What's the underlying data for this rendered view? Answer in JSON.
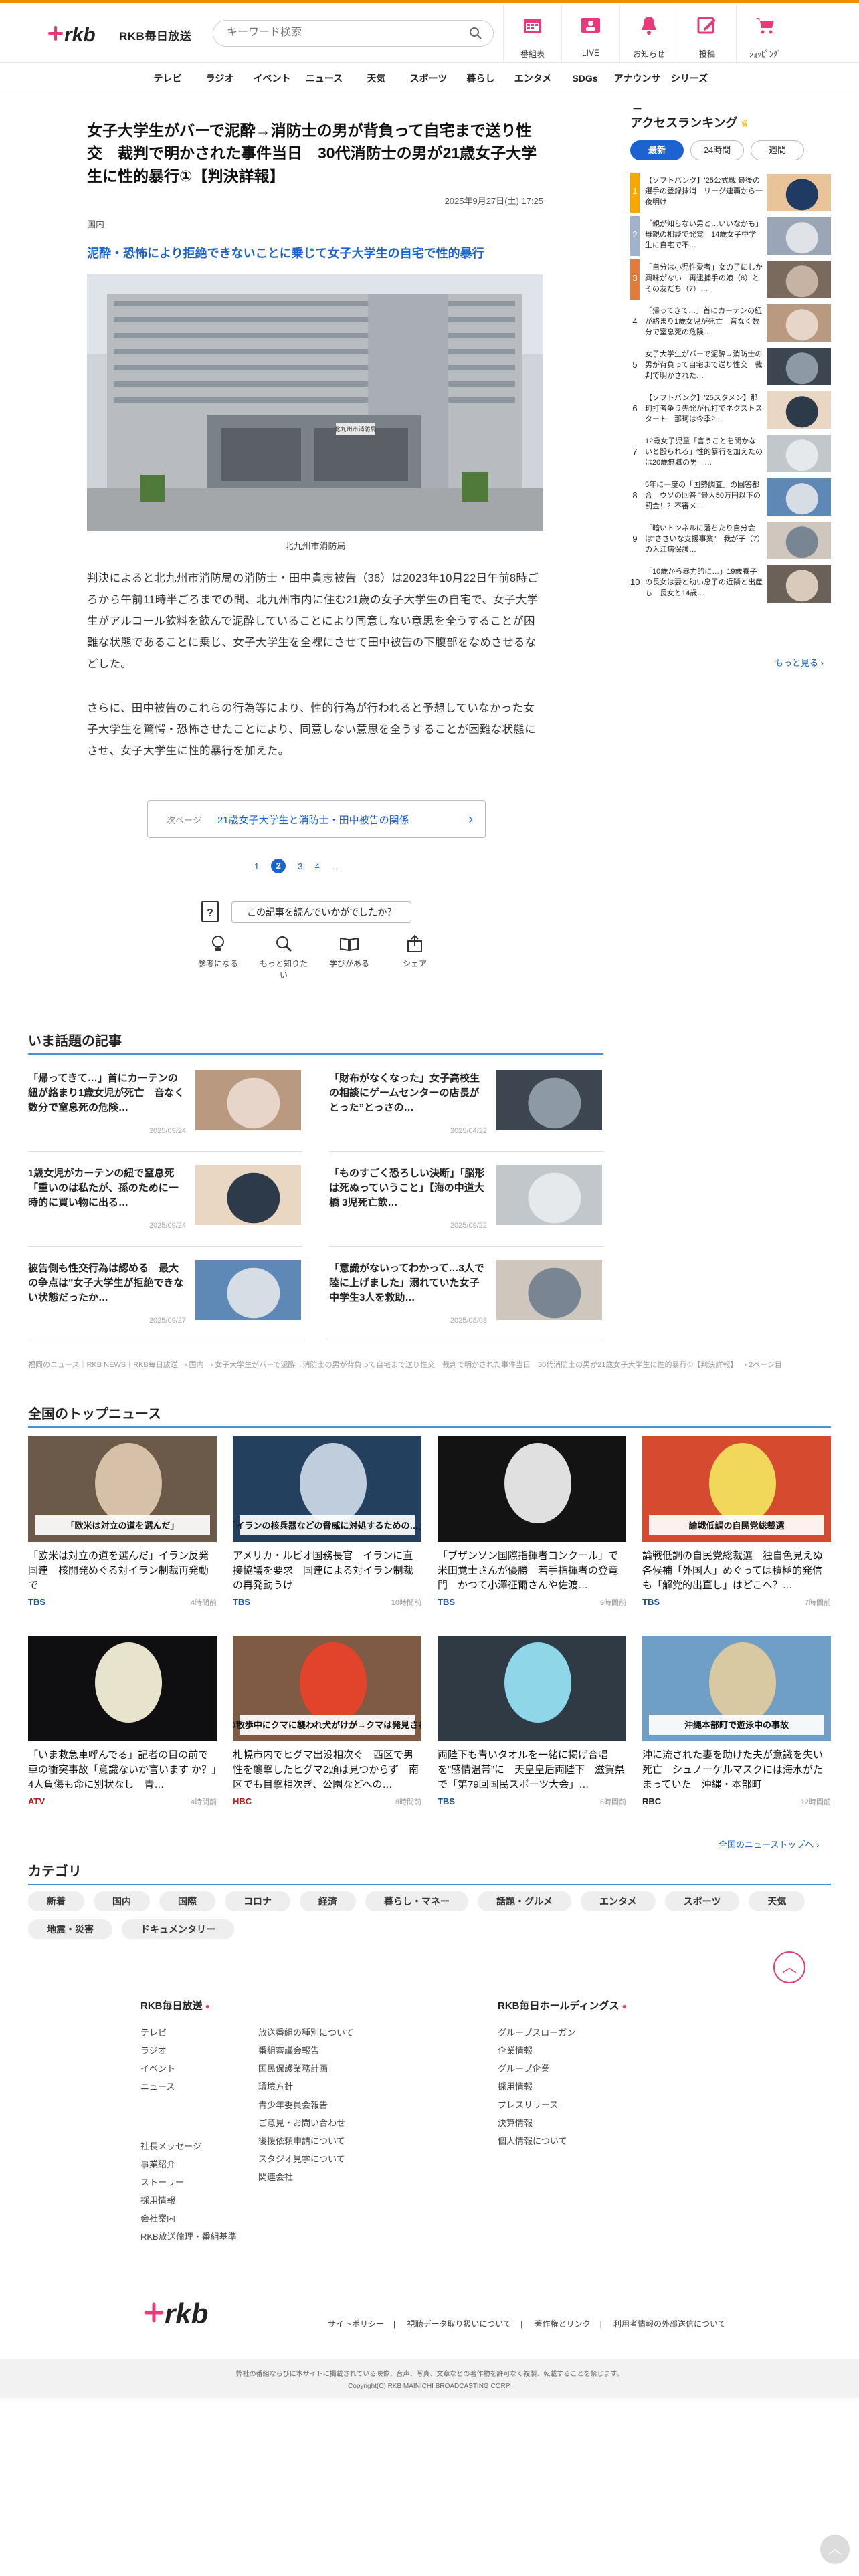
{
  "header": {
    "logo_text": "rkb",
    "brand": "RKB毎日放送",
    "search_placeholder": "キーワード検索",
    "tools": [
      {
        "label": "番組表",
        "icon": "calendar-icon"
      },
      {
        "label": "LIVE",
        "icon": "live-icon"
      },
      {
        "label": "お知らせ",
        "icon": "bell-icon"
      },
      {
        "label": "投稿",
        "icon": "post-icon"
      },
      {
        "label": "ｼｮｯﾋﾟﾝｸﾞ",
        "icon": "cart-icon"
      }
    ]
  },
  "gnav": [
    "テレビ",
    "ラジオ",
    "イベント",
    "ニュース",
    "天気",
    "スポーツ",
    "暮らし",
    "エンタメ",
    "SDGs",
    "アナウンサー",
    "シリーズ"
  ],
  "article": {
    "title": "女子大学生がバーで泥酔→消防士の男が背負って自宅まで送り性交　裁判で明かされた事件当日　30代消防士の男が21歳女子大学生に性的暴行①【判決詳報】",
    "date": "2025年9月27日(土) 17:25",
    "category": "国内",
    "subhead": "泥酔・恐怖により拒絶できないことに乗じて女子大学生の自宅で性的暴行",
    "photo_caption": "北九州市消防局",
    "photo_sign": "北九州市消防局",
    "paragraphs": [
      "判決によると北九州市消防局の消防士・田中貴志被告（36）は2023年10月22日午前8時ごろから午前11時半ごろまでの間、北九州市内に住む21歳の女子大学生の自宅で、女子大学生がアルコール飲料を飲んで泥酔していることにより同意しない意思を全うすることが困難な状態であることに乗じ、女子大学生を全裸にさせて田中被告の下腹部をなめさせるなどした。",
      "さらに、田中被告のこれらの行為等により、性的行為が行われると予想していなかった女子大学生を驚愕・恐怖させたことにより、同意しない意思を全うすることが困難な状態にさせ、女子大学生に性的暴行を加えた。"
    ],
    "next": {
      "label": "次ページ",
      "title": "21歳女子大学生と消防士・田中被告の関係"
    },
    "pages": [
      "1",
      "2",
      "3",
      "4",
      "…"
    ],
    "current_page": "2",
    "survey": {
      "question": "この記事を読んでいかがでしたか？",
      "reactions": [
        {
          "label": "参考になる",
          "icon": "lightbulb-icon"
        },
        {
          "label": "もっと知りたい",
          "icon": "magnifier-icon"
        },
        {
          "label": "学びがある",
          "icon": "book-icon"
        },
        {
          "label": "シェア",
          "icon": "share-icon"
        }
      ]
    }
  },
  "ranking": {
    "title": "アクセスランキング",
    "tabs": [
      "最新",
      "24時間",
      "週間"
    ],
    "active_tab": "最新",
    "items": [
      {
        "num": "1",
        "text": "【ソフトバンク】'25公式戦 最後の選手の登録抹消　リーグ連覇から一夜明け"
      },
      {
        "num": "2",
        "text": "「親が知らない男と…いいなかも」母親の相談で発覚　14歳女子中学生に自宅で不…"
      },
      {
        "num": "3",
        "text": "「自分は小児性愛者」女の子にしか興味がない　再逮捕手の娘（8）とその友だち（7）…"
      },
      {
        "num": "4",
        "text": "「帰ってきて…」首にカーテンの紐が絡まり1歳女児が死亡　音なく数分で窒息死の危険…"
      },
      {
        "num": "5",
        "text": "女子大学生がバーで泥酔→消防士の男が背負って自宅まで送り性交　裁判で明かされた…"
      },
      {
        "num": "6",
        "text": "【ソフトバンク】'25スタメン】那珂打者争う先発が代打でネクストスタート　那珂は今季2…"
      },
      {
        "num": "7",
        "text": "12歳女子児童「言うことを聞かないと殴られる」性的暴行を加えたのは20歳無職の男　…"
      },
      {
        "num": "8",
        "text": "5年に一度の「国勢調査」の回答都合＝ウソの回答 ”最大50万円以下の罰金！？不審メ…"
      },
      {
        "num": "9",
        "text": "「暗いトンネルに落ちたり自分会は”ささいな支援事業”　我が子（7）の入江病保護…"
      },
      {
        "num": "10",
        "text": "「10歳から暴力的に…」19歳養子の長女は妻と幼い息子の近隣と出産も　長女と14歳…"
      }
    ],
    "more": "もっと見る ›"
  },
  "topics": {
    "heading": "いま話題の記事",
    "items": [
      {
        "title": "「帰ってきて…」首にカーテンの紐が絡まり1歳女児が死亡　音なく数分で窒息死の危険…",
        "date": "2025/09/24"
      },
      {
        "title": "「財布がなくなった」女子高校生の相談にゲームセンターの店長がとった”とっさの…",
        "date": "2025/04/22"
      },
      {
        "title": "1歳女児がカーテンの紐で窒息死「重いのは私たが、孫のために一時的に買い物に出る…",
        "date": "2025/09/24"
      },
      {
        "title": "「ものすごく恐ろしい決断」「脳形は死ぬっていうこと」【海の中道大橋 3児死亡飲…",
        "date": "2025/09/22"
      },
      {
        "title": "被告側も性交行為は認める　最大の争点は”女子大学生が拒絶できない状態だったか…",
        "date": "2025/09/27"
      },
      {
        "title": "「意識がないってわかって…3人で陸に上げました」溺れていた女子中学生3人を救助…",
        "date": "2025/08/03"
      }
    ]
  },
  "breadcrumb": [
    "福岡のニュース｜RKB NEWS｜RKB毎日放送",
    "国内",
    "女子大学生がバーで泥酔→消防士の男が背負って自宅まで送り性交　裁判で明かされた事件当日　30代消防士の男が21歳女子大学生に性的暴行①【判決詳報】",
    "2ページ目"
  ],
  "national": {
    "heading": "全国のトップニュース",
    "items": [
      {
        "title": "「欧米は対立の道を選んだ」イラン反発　国連　核開発めぐる対イラン制裁再発動で",
        "source": "TBS",
        "time": "4時間前",
        "src_color": "#1c4fa3",
        "caption": "「欧米は対立の道を選んだ」"
      },
      {
        "title": "アメリカ・ルビオ国務長官　イランに直接協議を要求　国連による対イラン制裁の再発動うけ",
        "source": "TBS",
        "time": "10時間前",
        "src_color": "#1c4fa3",
        "caption": "「イランの核兵器などの脅威に対処するための…」"
      },
      {
        "title": "「ブザンソン国際指揮者コンクール」で米田覚士さんが優勝　若手指揮者の登竜門　かつて小澤征爾さんや佐渡…",
        "source": "TBS",
        "time": "9時間前",
        "src_color": "#1c4fa3",
        "caption": ""
      },
      {
        "title": "論戦低調の自民党総裁選　独自色見えぬ各候補「外国人」めぐっては積極的発信も「解党的出直し」はどこへ？…",
        "source": "TBS",
        "time": "7時間前",
        "src_color": "#1c4fa3",
        "caption": "論戦低調の自民党総裁選"
      },
      {
        "title": "「いま救急車呼んでる」記者の目の前で車の衝突事故「意識ないか言います か？」4人負傷も命に別状なし　青…",
        "source": "ATV",
        "time": "4時間前",
        "src_color": "#c01818",
        "caption": ""
      },
      {
        "title": "札幌市内でヒグマ出没相次ぐ　西区で男性を襲撃したヒグマ2頭は見つからず　南区でも目撃相次ぎ、公園などへの…",
        "source": "HBC",
        "time": "8時間前",
        "src_color": "#c01818",
        "caption": "犬の散歩中にクマに襲われ犬がけが→クマは発見されず"
      },
      {
        "title": "両陛下も青いタオルを一緒に掲げ合唱を”感情温帯”に　天皇皇后両陛下　滋賀県で「第79回国民スポーツ大会」…",
        "source": "TBS",
        "time": "6時間前",
        "src_color": "#1c4fa3",
        "caption": ""
      },
      {
        "title": "沖に流された妻を助けた夫が意識を失い死亡　シュノーケルマスクには海水がたまっていた　沖縄・本部町",
        "source": "RBC",
        "time": "12時間前",
        "src_color": "#222222",
        "caption": "沖縄本部町で遊泳中の事故"
      }
    ],
    "more": "全国のニューストップへ ›"
  },
  "categories": {
    "heading": "カテゴリ",
    "items": [
      "新着",
      "国内",
      "国際",
      "コロナ",
      "経済",
      "暮らし・マネー",
      "話題・グルメ",
      "エンタメ",
      "スポーツ",
      "天気",
      "地震・災害",
      "ドキュメンタリー"
    ]
  },
  "footer": {
    "rkb_heading": "RKB毎日放送",
    "hd_heading": "RKB毎日ホールディングス",
    "col1": [
      "テレビ",
      "ラジオ",
      "イベント",
      "ニュース"
    ],
    "col1b": [
      "社長メッセージ",
      "事業紹介",
      "ストーリー",
      "採用情報",
      "会社案内",
      "RKB放送倫理・番組基準"
    ],
    "col2": [
      "放送番組の種別について",
      "番組審議会報告",
      "国民保護業務計画",
      "環境方針",
      "青少年委員会報告",
      "ご意見・お問い合わせ",
      "後援依頼申請について",
      "スタジオ見学について",
      "関連会社"
    ],
    "col3": [
      "グループスローガン",
      "企業情報",
      "グループ企業",
      "採用情報",
      "プレスリリース",
      "決算情報",
      "個人情報について"
    ],
    "links": [
      "サイトポリシー",
      "視聴データ取り扱いについて",
      "著作権とリンク",
      "利用者情報の外部送信について"
    ],
    "notice": "弊社の番組ならびに本サイトに掲載されている映像、音声、写真、文章などの著作物を許可なく複製、転載することを禁じます。",
    "copyright": "Copyright(C) RKB MAINICHI BROADCASTING CORP."
  },
  "colors": {
    "accent": "#1c63d1",
    "brand_pink": "#e8397a",
    "top_border": "#f28b00"
  }
}
